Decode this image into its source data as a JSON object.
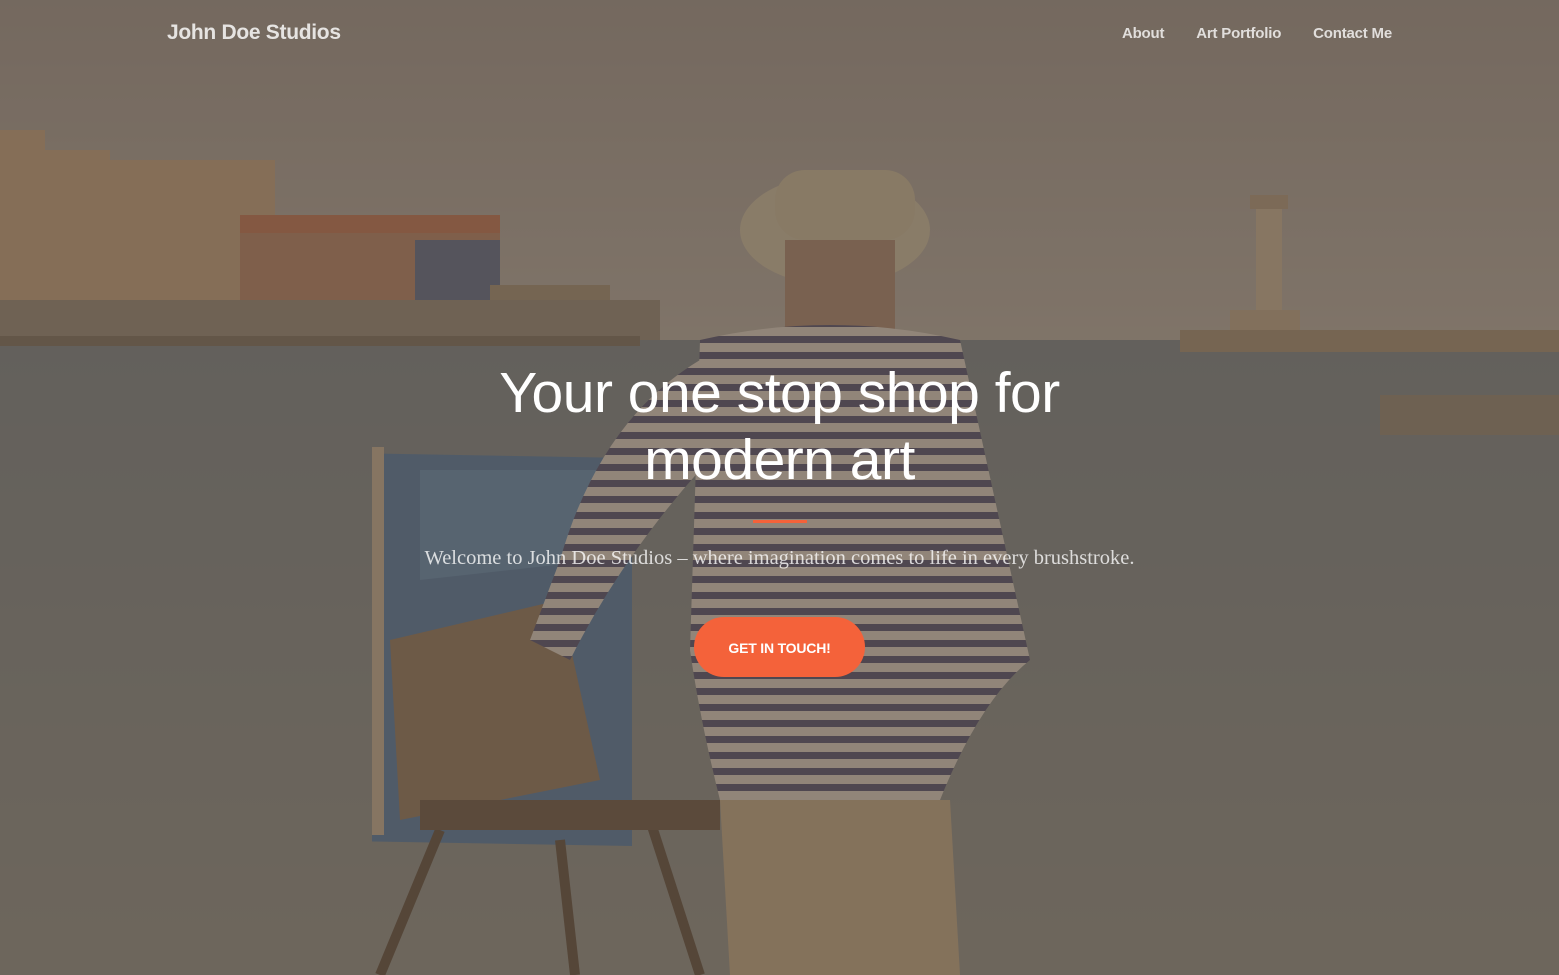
{
  "navbar": {
    "brand": "John Doe Studios",
    "links": [
      {
        "label": "About"
      },
      {
        "label": "Art Portfolio"
      },
      {
        "label": "Contact Me"
      }
    ]
  },
  "hero": {
    "title": "Your one stop shop for modern art",
    "subtitle": "Welcome to John Doe Studios – where imagination comes to life in every brushstroke.",
    "cta_label": "GET IN TOUCH!"
  },
  "theme": {
    "accent": "#f4623a",
    "overlay": "#5c4e40"
  },
  "background": {
    "image_subject": "painter-at-harbor-photo"
  }
}
